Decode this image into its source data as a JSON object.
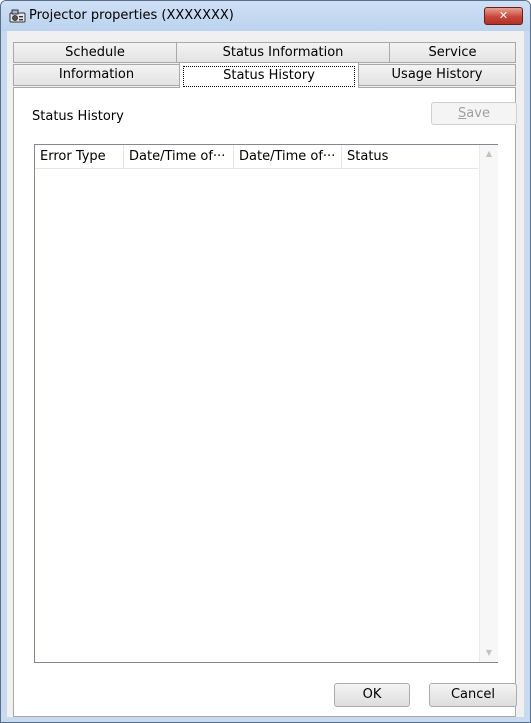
{
  "window": {
    "title": "Projector properties (XXXXXXX)",
    "close_glyph": "✕",
    "accent": "#c8daf0",
    "close_color": "#c7473a"
  },
  "icons": {
    "app": "projector-icon",
    "close": "close-icon",
    "scroll_up": "scroll-up-arrow-icon",
    "scroll_down": "scroll-down-arrow-icon"
  },
  "tabs": {
    "row1": [
      "Schedule",
      "Status Information",
      "Service"
    ],
    "row2": [
      "Information",
      "Status History",
      "Usage History"
    ],
    "active": "Status History"
  },
  "panel": {
    "section_label": "Status History",
    "save_button": {
      "prefix": "",
      "mnemonic": "S",
      "rest": "ave",
      "enabled": false
    }
  },
  "table": {
    "columns": [
      "Error Type",
      "Date/Time of···",
      "Date/Time of···",
      "Status"
    ],
    "rows": []
  },
  "footer": {
    "ok_label": "OK",
    "cancel_label": "Cancel"
  }
}
